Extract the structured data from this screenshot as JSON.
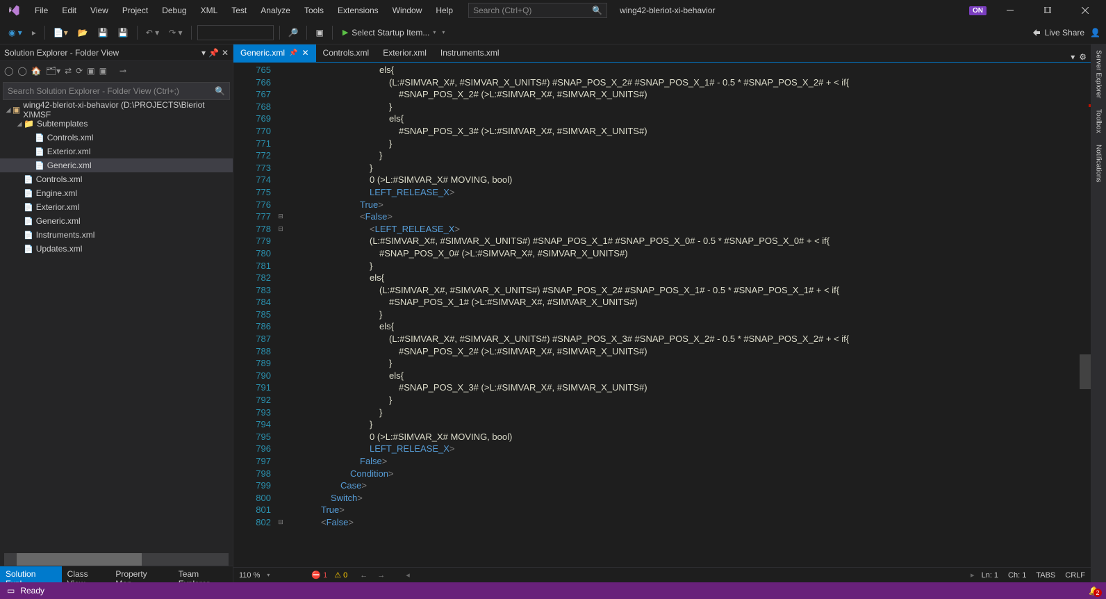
{
  "menu": [
    "File",
    "Edit",
    "View",
    "Project",
    "Debug",
    "XML",
    "Test",
    "Analyze",
    "Tools",
    "Extensions",
    "Window",
    "Help"
  ],
  "search_placeholder": "Search (Ctrl+Q)",
  "project_name": "wing42-bleriot-xi-behavior",
  "on_badge": "ON",
  "start_label": "Select Startup Item...",
  "liveshare_label": "Live Share",
  "solution": {
    "title": "Solution Explorer - Folder View",
    "search_placeholder": "Search Solution Explorer - Folder View (Ctrl+;)",
    "root": "wing42-bleriot-xi-behavior (D:\\PROJECTS\\Bleriot XI\\MSF",
    "folder": "Subtemplates",
    "sub_files": [
      "Controls.xml",
      "Exterior.xml",
      "Generic.xml"
    ],
    "root_files": [
      "Controls.xml",
      "Engine.xml",
      "Exterior.xml",
      "Generic.xml",
      "Instruments.xml",
      "Updates.xml"
    ],
    "tabs": [
      "Solution Expl...",
      "Class View",
      "Property Man...",
      "Team Explorer"
    ]
  },
  "doc_tabs": [
    "Generic.xml",
    "Controls.xml",
    "Exterior.xml",
    "Instruments.xml"
  ],
  "code_lines": [
    {
      "n": 765,
      "indent": 76,
      "segs": [
        {
          "t": "els{",
          "c": "c-text"
        }
      ]
    },
    {
      "n": 766,
      "indent": 90,
      "segs": [
        {
          "t": "(L:#SIMVAR_X#, #SIMVAR_X_UNITS#) #SNAP_POS_X_2# #SNAP_POS_X_1# - 0.5 * #SNAP_POS_X_2# + &lt; if{",
          "c": "c-text"
        }
      ]
    },
    {
      "n": 767,
      "indent": 104,
      "segs": [
        {
          "t": "#SNAP_POS_X_2# (&gt;L:#SIMVAR_X#, #SIMVAR_X_UNITS#)",
          "c": "c-text"
        }
      ]
    },
    {
      "n": 768,
      "indent": 90,
      "segs": [
        {
          "t": "}",
          "c": "c-text"
        }
      ]
    },
    {
      "n": 769,
      "indent": 90,
      "segs": [
        {
          "t": "els{",
          "c": "c-text"
        }
      ]
    },
    {
      "n": 770,
      "indent": 104,
      "segs": [
        {
          "t": "#SNAP_POS_X_3# (&gt;L:#SIMVAR_X#, #SIMVAR_X_UNITS#)",
          "c": "c-text"
        }
      ]
    },
    {
      "n": 771,
      "indent": 90,
      "segs": [
        {
          "t": "}",
          "c": "c-text"
        }
      ]
    },
    {
      "n": 772,
      "indent": 76,
      "segs": [
        {
          "t": "}",
          "c": "c-text"
        }
      ]
    },
    {
      "n": 773,
      "indent": 62,
      "segs": [
        {
          "t": "}",
          "c": "c-text"
        }
      ]
    },
    {
      "n": 774,
      "indent": 62,
      "segs": [
        {
          "t": "0 (&gt;L:#SIMVAR_X# MOVING, bool)",
          "c": "c-text"
        }
      ]
    },
    {
      "n": 775,
      "indent": 62,
      "segs": [
        {
          "t": "</",
          "c": "c-angle"
        },
        {
          "t": "LEFT_RELEASE_X",
          "c": "c-tag"
        },
        {
          "t": ">",
          "c": "c-angle"
        }
      ]
    },
    {
      "n": 776,
      "indent": 48,
      "segs": [
        {
          "t": "</",
          "c": "c-angle"
        },
        {
          "t": "True",
          "c": "c-tag"
        },
        {
          "t": ">",
          "c": "c-angle"
        }
      ]
    },
    {
      "n": 777,
      "indent": 48,
      "segs": [
        {
          "t": "<",
          "c": "c-angle"
        },
        {
          "t": "False",
          "c": "c-tag"
        },
        {
          "t": ">",
          "c": "c-angle"
        }
      ],
      "fold": "-"
    },
    {
      "n": 778,
      "indent": 62,
      "segs": [
        {
          "t": "<",
          "c": "c-angle"
        },
        {
          "t": "LEFT_RELEASE_X",
          "c": "c-tag"
        },
        {
          "t": ">",
          "c": "c-angle"
        }
      ],
      "fold": "-"
    },
    {
      "n": 779,
      "indent": 62,
      "segs": [
        {
          "t": "(L:#SIMVAR_X#, #SIMVAR_X_UNITS#) #SNAP_POS_X_1# #SNAP_POS_X_0# - 0.5 * #SNAP_POS_X_0# + &lt; if{",
          "c": "c-text"
        }
      ]
    },
    {
      "n": 780,
      "indent": 76,
      "segs": [
        {
          "t": "#SNAP_POS_X_0# (&gt;L:#SIMVAR_X#, #SIMVAR_X_UNITS#)",
          "c": "c-text"
        }
      ]
    },
    {
      "n": 781,
      "indent": 62,
      "segs": [
        {
          "t": "}",
          "c": "c-text"
        }
      ]
    },
    {
      "n": 782,
      "indent": 62,
      "segs": [
        {
          "t": "els{",
          "c": "c-text"
        }
      ]
    },
    {
      "n": 783,
      "indent": 76,
      "segs": [
        {
          "t": "(L:#SIMVAR_X#, #SIMVAR_X_UNITS#) #SNAP_POS_X_2# #SNAP_POS_X_1# - 0.5 * #SNAP_POS_X_1# + &lt; if{",
          "c": "c-text"
        }
      ]
    },
    {
      "n": 784,
      "indent": 90,
      "segs": [
        {
          "t": "#SNAP_POS_X_1# (&gt;L:#SIMVAR_X#, #SIMVAR_X_UNITS#)",
          "c": "c-text"
        }
      ]
    },
    {
      "n": 785,
      "indent": 76,
      "segs": [
        {
          "t": "}",
          "c": "c-text"
        }
      ]
    },
    {
      "n": 786,
      "indent": 76,
      "segs": [
        {
          "t": "els{",
          "c": "c-text"
        }
      ]
    },
    {
      "n": 787,
      "indent": 90,
      "segs": [
        {
          "t": "(L:#SIMVAR_X#, #SIMVAR_X_UNITS#) #SNAP_POS_X_3# #SNAP_POS_X_2# - 0.5 * #SNAP_POS_X_2# + &lt; if{",
          "c": "c-text"
        }
      ]
    },
    {
      "n": 788,
      "indent": 104,
      "segs": [
        {
          "t": "#SNAP_POS_X_2# (&gt;L:#SIMVAR_X#, #SIMVAR_X_UNITS#)",
          "c": "c-text"
        }
      ]
    },
    {
      "n": 789,
      "indent": 90,
      "segs": [
        {
          "t": "}",
          "c": "c-text"
        }
      ]
    },
    {
      "n": 790,
      "indent": 90,
      "segs": [
        {
          "t": "els{",
          "c": "c-text"
        }
      ]
    },
    {
      "n": 791,
      "indent": 104,
      "segs": [
        {
          "t": "#SNAP_POS_X_3# (&gt;L:#SIMVAR_X#, #SIMVAR_X_UNITS#)",
          "c": "c-text"
        }
      ]
    },
    {
      "n": 792,
      "indent": 90,
      "segs": [
        {
          "t": "}",
          "c": "c-text"
        }
      ]
    },
    {
      "n": 793,
      "indent": 76,
      "segs": [
        {
          "t": "}",
          "c": "c-text"
        }
      ]
    },
    {
      "n": 794,
      "indent": 62,
      "segs": [
        {
          "t": "}",
          "c": "c-text"
        }
      ]
    },
    {
      "n": 795,
      "indent": 62,
      "segs": [
        {
          "t": "0 (&gt;L:#SIMVAR_X# MOVING, bool)",
          "c": "c-text"
        }
      ]
    },
    {
      "n": 796,
      "indent": 62,
      "segs": [
        {
          "t": "</",
          "c": "c-angle"
        },
        {
          "t": "LEFT_RELEASE_X",
          "c": "c-tag"
        },
        {
          "t": ">",
          "c": "c-angle"
        }
      ]
    },
    {
      "n": 797,
      "indent": 48,
      "segs": [
        {
          "t": "</",
          "c": "c-angle"
        },
        {
          "t": "False",
          "c": "c-tag"
        },
        {
          "t": ">",
          "c": "c-angle"
        }
      ]
    },
    {
      "n": 798,
      "indent": 34,
      "segs": [
        {
          "t": "</",
          "c": "c-angle"
        },
        {
          "t": "Condition",
          "c": "c-tag"
        },
        {
          "t": ">",
          "c": "c-angle"
        }
      ]
    },
    {
      "n": 799,
      "indent": 20,
      "segs": [
        {
          "t": "</",
          "c": "c-angle"
        },
        {
          "t": "Case",
          "c": "c-tag"
        },
        {
          "t": ">",
          "c": "c-angle"
        }
      ]
    },
    {
      "n": 800,
      "indent": 6,
      "segs": [
        {
          "t": "</",
          "c": "c-angle"
        },
        {
          "t": "Switch",
          "c": "c-tag"
        },
        {
          "t": ">",
          "c": "c-angle"
        }
      ]
    },
    {
      "n": 801,
      "indent": -8,
      "segs": [
        {
          "t": "</",
          "c": "c-angle"
        },
        {
          "t": "True",
          "c": "c-tag"
        },
        {
          "t": ">",
          "c": "c-angle"
        }
      ]
    },
    {
      "n": 802,
      "indent": -8,
      "segs": [
        {
          "t": "<",
          "c": "c-angle"
        },
        {
          "t": "False",
          "c": "c-tag"
        },
        {
          "t": ">",
          "c": "c-angle"
        }
      ],
      "fold": "-"
    }
  ],
  "editor_status": {
    "zoom": "110 %",
    "errors": "1",
    "warnings": "0",
    "ln": "Ln: 1",
    "ch": "Ch: 1",
    "tabs": "TABS",
    "crlf": "CRLF"
  },
  "right_tabs": [
    "Server Explorer",
    "Toolbox",
    "Notifications"
  ],
  "bottom_status": "Ready",
  "bell_count": "2"
}
